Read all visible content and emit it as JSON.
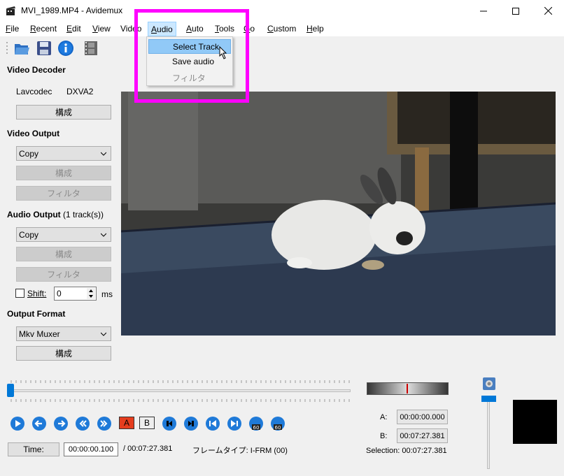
{
  "window": {
    "title": "MVI_1989.MP4 - Avidemux",
    "minimize": "—",
    "maximize": "☐",
    "close": "✕"
  },
  "menubar": {
    "items": [
      {
        "label": "File",
        "mnemonic": "F",
        "rest": "ile"
      },
      {
        "label": "Recent",
        "mnemonic": "R",
        "rest": "ecent"
      },
      {
        "label": "Edit",
        "mnemonic": "E",
        "rest": "dit"
      },
      {
        "label": "View",
        "mnemonic": "V",
        "rest": "iew"
      },
      {
        "label": "Video",
        "mnemonic": "",
        "rest": "Video"
      },
      {
        "label": "Audio",
        "mnemonic": "A",
        "rest": "udio"
      },
      {
        "label": "Auto",
        "mnemonic": "A",
        "rest": "uto"
      },
      {
        "label": "Tools",
        "mnemonic": "T",
        "rest": "ools"
      },
      {
        "label": "Go",
        "mnemonic": "G",
        "rest": "o"
      },
      {
        "label": "Custom",
        "mnemonic": "C",
        "rest": "ustom"
      },
      {
        "label": "Help",
        "mnemonic": "H",
        "rest": "elp"
      }
    ]
  },
  "audio_menu": {
    "items": [
      "Select Track",
      "Save audio",
      "フィルタ"
    ]
  },
  "left_panel": {
    "video_decoder": {
      "title": "Video Decoder",
      "codec": "Lavcodec",
      "hw": "DXVA2",
      "configure": "構成"
    },
    "video_output": {
      "title": "Video Output",
      "value": "Copy",
      "configure": "構成",
      "filters": "フィルタ"
    },
    "audio_output": {
      "title": "Audio Output",
      "tracks": "(1 track(s))",
      "value": "Copy",
      "configure": "構成",
      "filters": "フィルタ",
      "shift_label": "Shift:",
      "shift_value": "0",
      "shift_unit": "ms"
    },
    "output_format": {
      "title": "Output Format",
      "value": "Mkv Muxer",
      "configure": "構成"
    }
  },
  "playback": {
    "marker_a_label": "A:",
    "marker_a_value": "00:00:00.000",
    "marker_b_label": "B:",
    "marker_b_value": "00:07:27.381",
    "selection": "Selection: 00:07:27.381",
    "time_button": "Time:",
    "current_time": "00:00:00.100",
    "total_time": "/ 00:07:27.381",
    "frame_type": "フレームタイプ: I-FRM (00)",
    "btn_a": "A",
    "btn_b": "B",
    "position": 0.0
  },
  "colors": {
    "accent": "#0078d7",
    "highlight_box": "#ff00ff",
    "menu_highlight": "#91c9f7"
  }
}
